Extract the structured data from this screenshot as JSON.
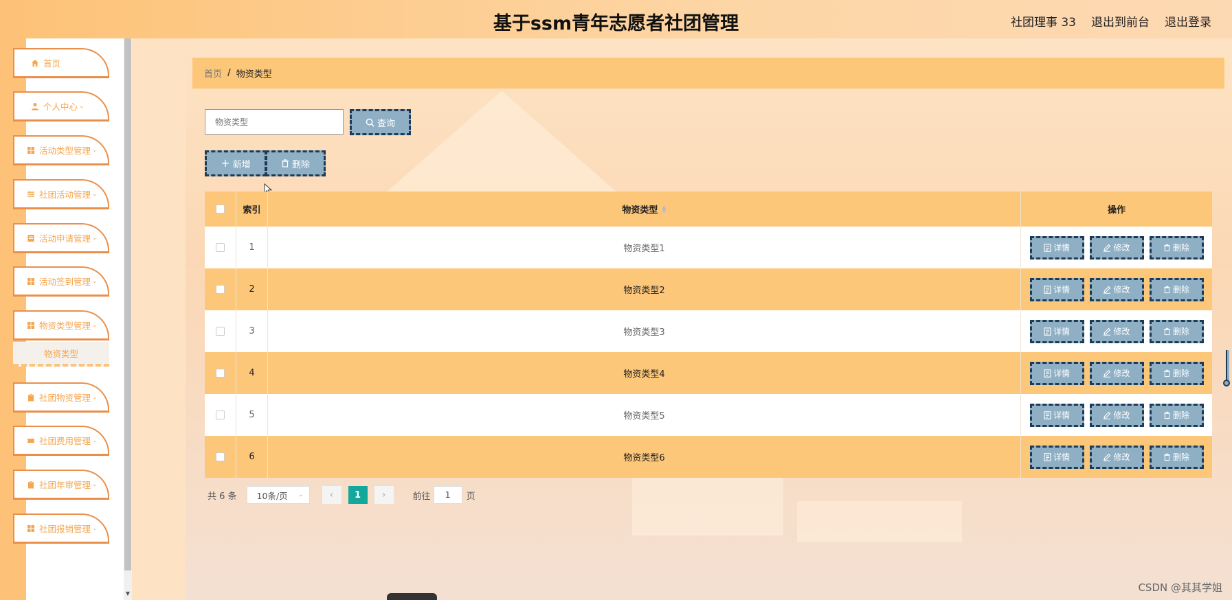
{
  "header": {
    "title": "基于ssm青年志愿者社团管理",
    "user": "社团理事 33",
    "goto_front": "退出到前台",
    "logout": "退出登录"
  },
  "sidebar": {
    "items": [
      {
        "label": "首页",
        "icon": "home-icon",
        "chevron": ""
      },
      {
        "label": "个人中心",
        "icon": "user-icon",
        "chevron": "⌄"
      },
      {
        "label": "活动类型管理",
        "icon": "grid-icon",
        "chevron": "⌄"
      },
      {
        "label": "社团活动管理",
        "icon": "sliders-icon",
        "chevron": "⌄"
      },
      {
        "label": "活动申请管理",
        "icon": "doc-icon",
        "chevron": "⌄"
      },
      {
        "label": "活动签到管理",
        "icon": "grid-icon",
        "chevron": "⌄"
      },
      {
        "label": "物资类型管理",
        "icon": "grid-icon",
        "chevron": "⌄"
      },
      {
        "label": "社团物资管理",
        "icon": "clipboard-icon",
        "chevron": "⌄"
      },
      {
        "label": "社团费用管理",
        "icon": "ticket-icon",
        "chevron": "⌄"
      },
      {
        "label": "社团年审管理",
        "icon": "clipboard-icon",
        "chevron": "⌄"
      },
      {
        "label": "社团报销管理",
        "icon": "grid-icon",
        "chevron": "⌄"
      }
    ],
    "sub_item": "物资类型"
  },
  "breadcrumb": {
    "home": "首页",
    "sep": "/",
    "current": "物资类型"
  },
  "search": {
    "placeholder": "物资类型",
    "button": "查询"
  },
  "actions": {
    "add": "新增",
    "delete": "删除"
  },
  "table": {
    "headers": {
      "index": "索引",
      "name": "物资类型",
      "ops": "操作"
    },
    "rows": [
      {
        "index": "1",
        "name": "物资类型1"
      },
      {
        "index": "2",
        "name": "物资类型2"
      },
      {
        "index": "3",
        "name": "物资类型3"
      },
      {
        "index": "4",
        "name": "物资类型4"
      },
      {
        "index": "5",
        "name": "物资类型5"
      },
      {
        "index": "6",
        "name": "物资类型6"
      }
    ],
    "op_labels": {
      "detail": "详情",
      "edit": "修改",
      "delete": "删除"
    }
  },
  "pagination": {
    "total": "共 6 条",
    "page_size": "10条/页",
    "current": "1",
    "goto_prefix": "前往",
    "goto_value": "1",
    "goto_suffix": "页"
  },
  "watermark": "CSDN @其其学姐",
  "colors": {
    "header_bg": "#fdc277",
    "accent_orange": "#fdc77a",
    "menu_border": "#ea8f4a",
    "button_bg": "#8eafc4",
    "button_border": "#1e3a55",
    "pager_active": "#14a79c"
  }
}
